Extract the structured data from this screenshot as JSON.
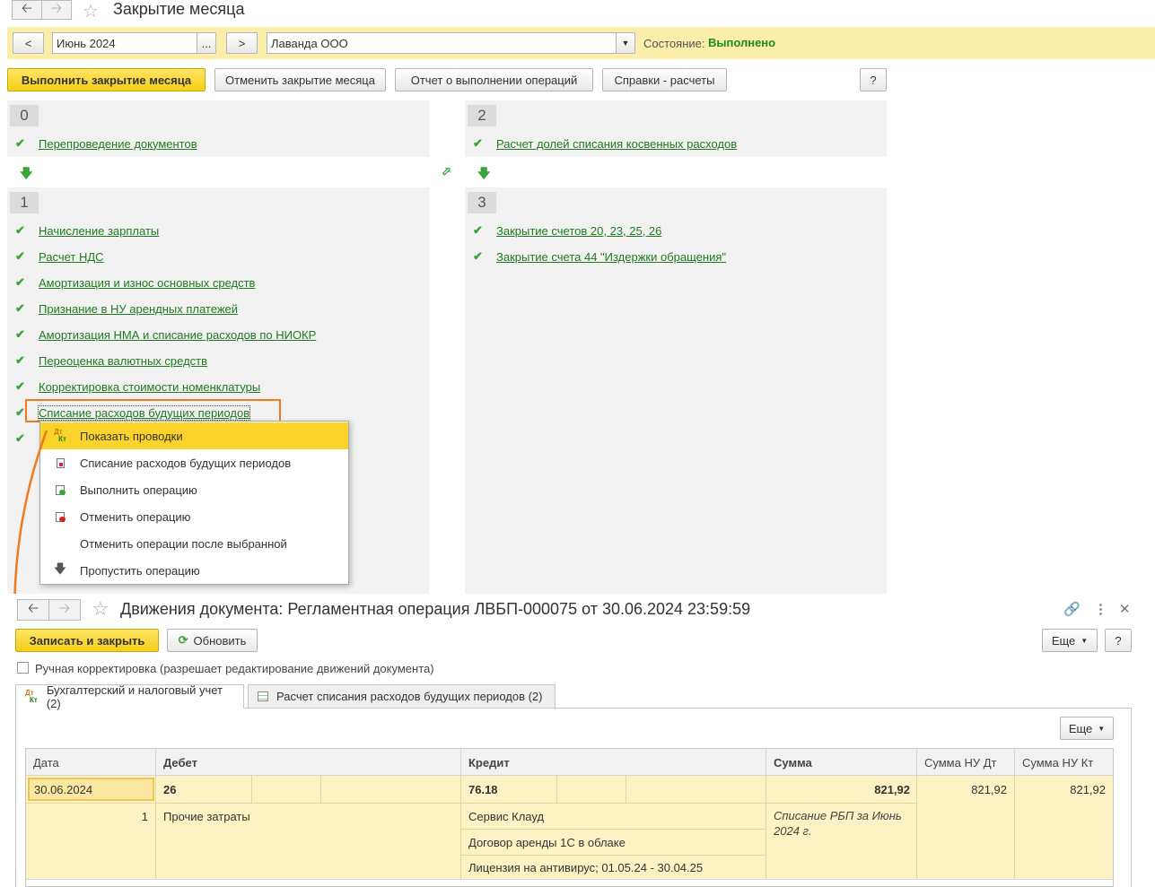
{
  "window": {
    "title": "Закрытие месяца"
  },
  "toolbar": {
    "prev_label": "<",
    "next_label": ">",
    "period": "Июнь 2024",
    "period_select": "...",
    "org": "Лаванда ООО",
    "status_label": "Состояние:",
    "status_value": "Выполнено",
    "status_color": "#1e8a1e"
  },
  "actions": {
    "perform": "Выполнить закрытие месяца",
    "cancel": "Отменить закрытие месяца",
    "report": "Отчет о выполнении операций",
    "references": "Справки - расчеты",
    "help": "?"
  },
  "steps": [
    {
      "num": "0",
      "operations": [
        "Перепроведение документов"
      ]
    },
    {
      "num": "1",
      "operations": [
        "Начисление зарплаты",
        "Расчет НДС",
        "Амортизация и износ основных средств",
        "Признание в НУ арендных платежей",
        "Амортизация НМА и списание расходов по НИОКР",
        "Переоценка валютных средств",
        "Корректировка стоимости номенклатуры",
        "Списание расходов будущих периодов"
      ]
    },
    {
      "num": "2",
      "operations": [
        "Расчет долей списания косвенных расходов"
      ]
    },
    {
      "num": "3",
      "operations": [
        "Закрытие счетов 20, 23, 25, 26",
        "Закрытие счета 44 \"Издержки обращения\""
      ]
    }
  ],
  "context_menu": {
    "items": [
      {
        "label": "Показать проводки",
        "icon": "dt-kt-icon"
      },
      {
        "label": "Списание расходов будущих периодов",
        "icon": "document-icon"
      },
      {
        "label": "Выполнить операцию",
        "icon": "run-operation-icon"
      },
      {
        "label": "Отменить операцию",
        "icon": "cancel-operation-icon"
      },
      {
        "label": "Отменить операции после выбранной",
        "icon": ""
      },
      {
        "label": "Пропустить операцию",
        "icon": "arrow-down-icon"
      }
    ]
  },
  "movements": {
    "title": "Движения документа: Регламентная операция ЛВБП-000075 от 30.06.2024 23:59:59",
    "save_close": "Записать и закрыть",
    "refresh": "Обновить",
    "more": "Еще",
    "help": "?",
    "manual_label": "Ручная корректировка (разрешает редактирование движений документа)",
    "tabs": [
      {
        "label": "Бухгалтерский и налоговый учет (2)"
      },
      {
        "label": "Расчет списания расходов будущих периодов (2)"
      }
    ],
    "table_more": "Еще",
    "columns": [
      "Дата",
      "Дебет",
      "Кредит",
      "Сумма",
      "Сумма НУ Дт",
      "Сумма НУ Кт"
    ],
    "row": {
      "date": "30.06.2024",
      "num": "1",
      "debit_account": "26",
      "debit_sub1": "Прочие затраты",
      "credit_account": "76.18",
      "credit_sub1": "Сервис Клауд",
      "credit_sub2": "Договор аренды 1С в облаке",
      "credit_sub3": "Лицензия на антивирус; 01.05.24 - 30.04.25",
      "sum": "821,92",
      "content": "Списание РБП за Июнь 2024 г.",
      "sum_nu_dt": "821,92",
      "sum_nu_kt": "821,92"
    }
  }
}
